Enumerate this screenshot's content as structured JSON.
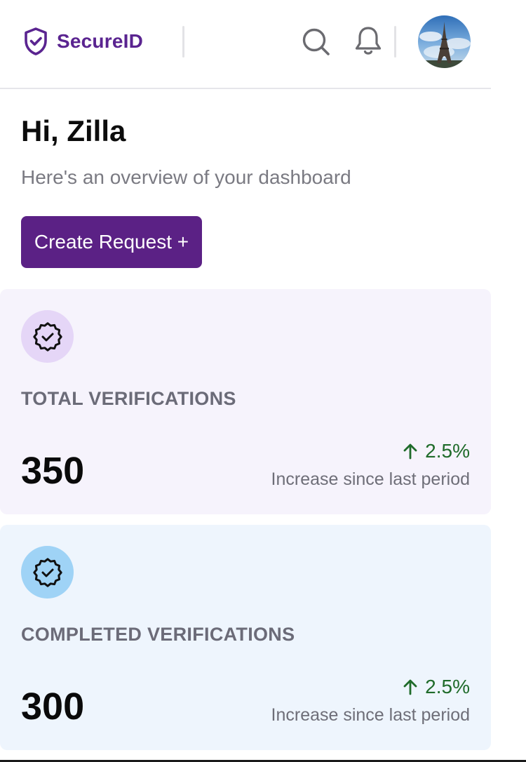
{
  "header": {
    "brand": "SecureID",
    "icons": [
      "shield-check-icon",
      "search-icon",
      "bell-icon"
    ],
    "brand_color": "#5a2490"
  },
  "greeting": {
    "title": "Hi, Zilla",
    "subtitle": "Here's an overview of your dashboard"
  },
  "actions": {
    "create_request_label": "Create Request +",
    "button_color": "#5b2185"
  },
  "cards": [
    {
      "label": "TOTAL VERIFICATIONS",
      "value": "350",
      "trend": "2.5%",
      "trend_note": "Increase since last period",
      "icon": "verified-badge-icon",
      "background": "#f6f3fc"
    },
    {
      "label": "COMPLETED VERIFICATIONS",
      "value": "300",
      "trend": "2.5%",
      "trend_note": "Increase since last period",
      "icon": "verified-badge-icon",
      "background": "#eef5fd"
    }
  ]
}
